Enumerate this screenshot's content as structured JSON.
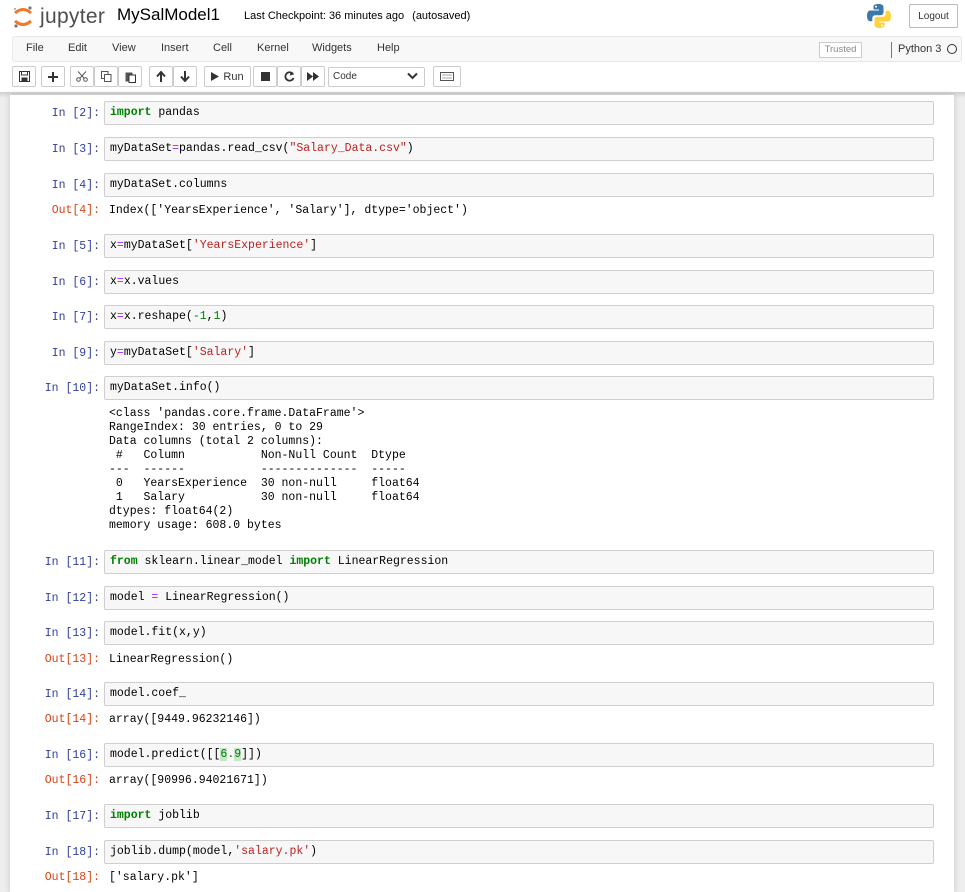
{
  "header": {
    "logo_text": "jupyter",
    "notebook_name": "MySalModel1",
    "checkpoint_label": "Last Checkpoint:",
    "checkpoint_time": "36 minutes ago",
    "autosave_status": "(autosaved)",
    "logout_label": "Logout"
  },
  "menubar": {
    "items": [
      "File",
      "Edit",
      "View",
      "Insert",
      "Cell",
      "Kernel",
      "Widgets",
      "Help"
    ],
    "trusted_label": "Trusted",
    "kernel_name": "Python 3"
  },
  "toolbar": {
    "run_label": "Run",
    "cell_type": "Code"
  },
  "cells": {
    "c1": {
      "prompt": "In [2]:"
    },
    "c2": {
      "prompt": "In [3]:"
    },
    "c3": {
      "prompt": "In [4]:",
      "out_prompt": "Out[4]:",
      "output": "Index(['YearsExperience', 'Salary'], dtype='object')"
    },
    "c4": {
      "prompt": "In [5]:"
    },
    "c5": {
      "prompt": "In [6]:"
    },
    "c6": {
      "prompt": "In [7]:"
    },
    "c7": {
      "prompt": "In [9]:"
    },
    "c8": {
      "prompt": "In [10]:",
      "output": "<class 'pandas.core.frame.DataFrame'>\nRangeIndex: 30 entries, 0 to 29\nData columns (total 2 columns):\n #   Column           Non-Null Count  Dtype  \n---  ------           --------------  -----  \n 0   YearsExperience  30 non-null     float64\n 1   Salary           30 non-null     float64\ndtypes: float64(2)\nmemory usage: 608.0 bytes"
    },
    "c9": {
      "prompt": "In [11]:"
    },
    "c10": {
      "prompt": "In [12]:"
    },
    "c11": {
      "prompt": "In [13]:",
      "out_prompt": "Out[13]:",
      "output": "LinearRegression()"
    },
    "c12": {
      "prompt": "In [14]:",
      "out_prompt": "Out[14]:",
      "output": "array([9449.96232146])"
    },
    "c13": {
      "prompt": "In [16]:",
      "out_prompt": "Out[16]:",
      "output": "array([90996.94021671])"
    },
    "c14": {
      "prompt": "In [17]:"
    },
    "c15": {
      "prompt": "In [18]:",
      "out_prompt": "Out[18]:",
      "output": "['salary.pk']"
    }
  },
  "code": {
    "c1": {
      "kw": "import",
      "rest": " pandas"
    },
    "c2": {
      "a": "myDataSet",
      "eq": "=",
      "b": "pandas.read_csv(",
      "s": "\"Salary_Data.csv\"",
      "c": ")"
    },
    "c3": {
      "text": "myDataSet.columns"
    },
    "c4": {
      "a": "x",
      "eq": "=",
      "b": "myDataSet[",
      "s": "'YearsExperience'",
      "c": "]"
    },
    "c5": {
      "a": "x",
      "eq": "=",
      "b": "x.values"
    },
    "c6": {
      "a": "x",
      "eq": "=",
      "b": "x.reshape(",
      "n1": "-1",
      "comma": ",",
      "n2": "1",
      "c": ")"
    },
    "c7": {
      "a": "y",
      "eq": "=",
      "b": "myDataSet[",
      "s": "'Salary'",
      "c": "]"
    },
    "c8": {
      "text": "myDataSet.info()"
    },
    "c9": {
      "kw1": "from",
      "mod": " sklearn.linear_model ",
      "kw2": "import",
      "rest": " LinearRegression"
    },
    "c10": {
      "a": "model ",
      "eq": "=",
      "b": " LinearRegression()"
    },
    "c11": {
      "text": "model.fit(x,y)"
    },
    "c12": {
      "text": "model.coef_"
    },
    "c13": {
      "a": "model.predict([[",
      "n1": "6",
      "dot": ".",
      "n2": "9",
      "c": "]])"
    },
    "c14": {
      "kw": "import",
      "rest": " joblib"
    },
    "c15": {
      "a": "joblib.dump(model,",
      "s": "'salary.pk'",
      "c": ")"
    }
  },
  "colors": {
    "in_prompt": "#303f9f",
    "out_prompt": "#d84315",
    "keyword": "#008000",
    "string": "#ba2121",
    "operator": "#aa22ff"
  }
}
